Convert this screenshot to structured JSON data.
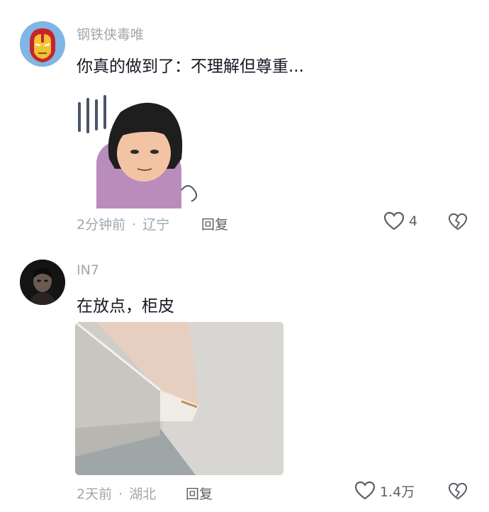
{
  "comments": [
    {
      "username": "钢铁侠毒唯",
      "text": "你真的做到了：不理解但尊重...",
      "time": "2分钟前",
      "location": "辽宁",
      "separator": "·",
      "reply_label": "回复",
      "likes": "4",
      "avatar_icon": "iron-man-avatar",
      "media": "meme-sticker-image"
    },
    {
      "username": "IN7",
      "text": "在放点，柜皮",
      "time": "2天前",
      "location": "湖北",
      "separator": "·",
      "reply_label": "回复",
      "likes": "1.4万",
      "avatar_icon": "dark-portrait-avatar",
      "media": "cabinet-edge-photo"
    }
  ],
  "colors": {
    "text_primary": "#161823",
    "text_secondary": "#a3a6ad",
    "action": "#5c5f66"
  }
}
